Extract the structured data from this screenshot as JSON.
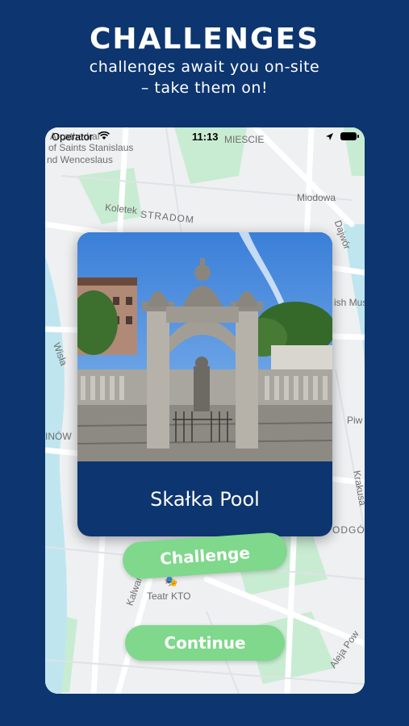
{
  "header": {
    "title": "CHALLENGES",
    "subtitle_line1": "challenges await you on-site",
    "subtitle_line2": "– take them on!"
  },
  "status_bar": {
    "carrier": "Operator",
    "time": "11:13"
  },
  "map_labels": {
    "cathedral": "Arcathedral",
    "saints": "of Saints Stanislaus",
    "wenceslaus": "nd Wenceslaus",
    "miescie": "MIESCIE",
    "miodowa": "Miodowa",
    "koletek": "Koletek",
    "stradom": "STRADOM",
    "dajwor": "Dajwór",
    "museum": "ish Mus",
    "wisla": "Wisła",
    "piwna": "Piw",
    "inow": "INÓW",
    "krakusa": "Krakusa",
    "podgorze": "ODGÓ",
    "kalwaryjska": "Kalwar",
    "teatr": "Teatr KTO",
    "aleja": "Aleja Pow"
  },
  "card": {
    "title": "Skałka Pool"
  },
  "buttons": {
    "challenge": "Challenge",
    "continue": "Continue"
  },
  "icons": {
    "wifi": "wifi-icon",
    "location": "location-arrow-icon",
    "battery": "battery-icon",
    "theater": "theater-masks-icon"
  },
  "colors": {
    "background": "#0d3570",
    "card_footer": "#0d3570",
    "button": "#7fd88c",
    "map_green": "#c8ecd2",
    "map_water": "#bfe6ef"
  }
}
